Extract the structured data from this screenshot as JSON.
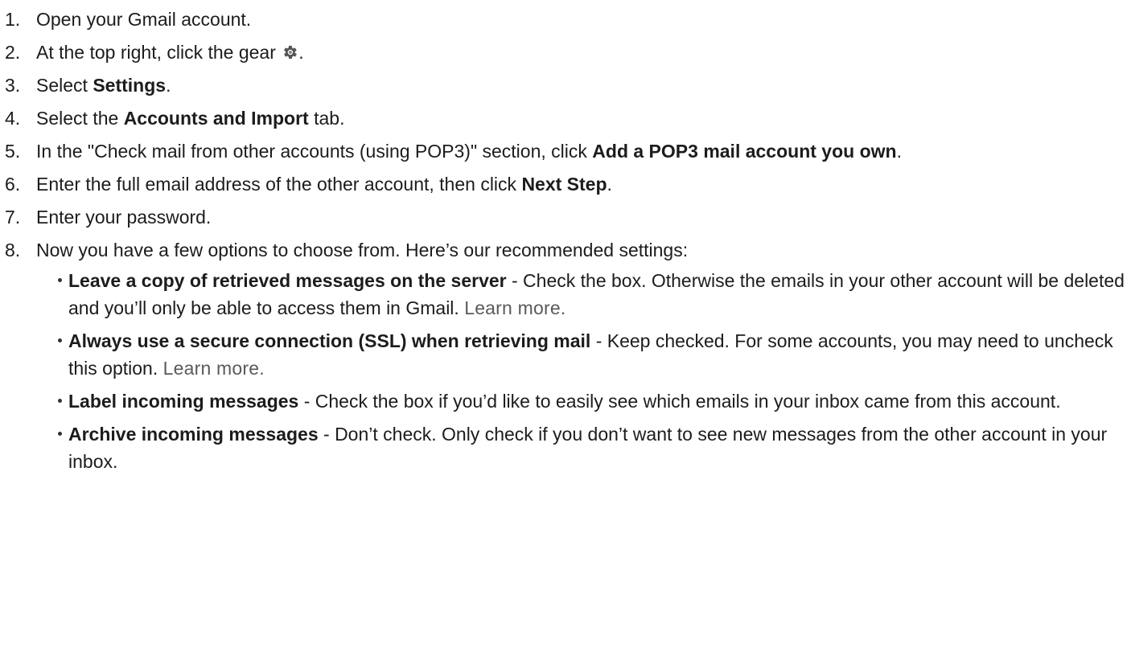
{
  "steps": [
    {
      "num": "1.",
      "text": "Open your Gmail account."
    },
    {
      "num": "2.",
      "pre": "At the top right, click the gear ",
      "icon": "gear-icon",
      "post": "."
    },
    {
      "num": "3.",
      "pre": "Select ",
      "bold": "Settings",
      "post": "."
    },
    {
      "num": "4.",
      "pre": "Select the ",
      "bold": "Accounts and Import",
      "post": " tab."
    },
    {
      "num": "5.",
      "pre": "In the \"Check mail from other accounts (using POP3)\" section, click ",
      "bold": "Add a POP3 mail account you own",
      "post": "."
    },
    {
      "num": "6.",
      "pre": "Enter the full email address of the other account, then click ",
      "bold": "Next Step",
      "post": "."
    },
    {
      "num": "7.",
      "text": "Enter your password."
    },
    {
      "num": "8.",
      "text": "Now you have a few options to choose from. Here’s our recommended settings:"
    }
  ],
  "options": [
    {
      "bold": "Leave a copy of retrieved messages on the server",
      "text": " - Check the box. Otherwise the emails in your other account will be deleted and you’ll only be able to access them in Gmail. ",
      "link": "Learn more."
    },
    {
      "bold": "Always use a secure connection (SSL) when retrieving mail",
      "text": " - Keep checked. For some accounts, you may need to uncheck this option. ",
      "link": "Learn more."
    },
    {
      "bold": "Label incoming messages",
      "text": " - Check the box if you’d like to easily see which emails in your inbox came from this account.",
      "link": ""
    },
    {
      "bold": "Archive incoming messages",
      "text": " - Don’t check. Only check if you don’t want to see new messages from the other account in your inbox.",
      "link": ""
    }
  ]
}
